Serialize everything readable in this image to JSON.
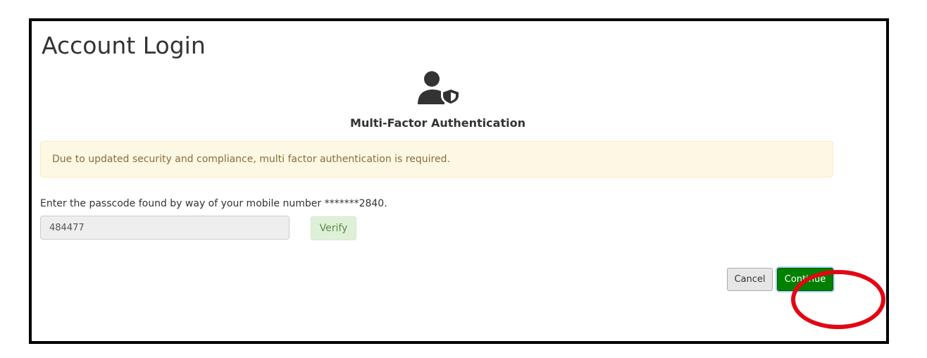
{
  "page": {
    "title": "Account Login"
  },
  "mfa": {
    "icon": "user-shield-icon",
    "title": "Multi-Factor Authentication",
    "notice": "Due to updated security and compliance, multi factor authentication is required.",
    "prompt": "Enter the passcode found by way of your mobile number *******2840.",
    "passcode_value": "484477",
    "verify_label": "Verify"
  },
  "actions": {
    "cancel_label": "Cancel",
    "continue_label": "Continue"
  },
  "colors": {
    "continue_bg": "#008000",
    "notice_bg": "#fcf8e3",
    "notice_text": "#8a6d3b",
    "verify_bg": "#dff0d8",
    "highlight_ring": "#e30613"
  }
}
